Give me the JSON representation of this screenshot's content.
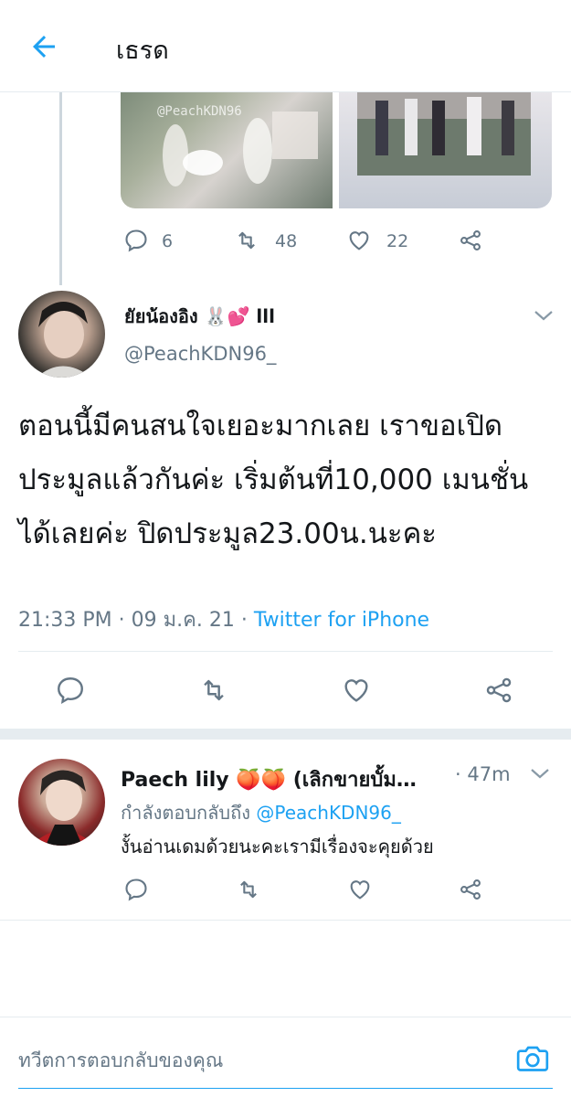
{
  "header": {
    "title": "เธรด",
    "back_icon": "arrow-left-icon"
  },
  "previous_tweet": {
    "media": [
      {
        "caption": "@PeachKDN96"
      },
      {
        "caption": ""
      }
    ],
    "actions": {
      "replies": "6",
      "retweets": "48",
      "likes": "22"
    }
  },
  "main_tweet": {
    "display_name": "ยัยน้องอิง 🐰💕 lll",
    "handle": "@PeachKDN96_",
    "text": "ตอนนี้มีคนสนใจเยอะมากเลย เราขอเปิดประมูลแล้วกันค่ะ เริ่มต้นที่10,000 เมนชั่นได้เลยค่ะ ปิดประมูล23.00น.นะคะ",
    "time": "21:33 PM",
    "date": "09 ม.ค. 21",
    "separator": "·",
    "source": "Twitter for iPhone"
  },
  "reply": {
    "display_name": "Paech lily 🍑🍑 (เลิกขายบั้ม…",
    "time": "· 47m",
    "replying_to_label": "กำลังตอบกลับถึง",
    "replying_to_handle": "@PeachKDN96_",
    "text": "งั้นอ่านเดมด้วยนะคะเรามีเรื่องจะคุยด้วย"
  },
  "compose": {
    "placeholder": "ทวีตการตอบกลับของคุณ",
    "camera_icon": "camera-icon"
  },
  "colors": {
    "accent": "#1da1f2",
    "muted": "#657786",
    "divider": "#e6ecf0",
    "text": "#14171a"
  }
}
